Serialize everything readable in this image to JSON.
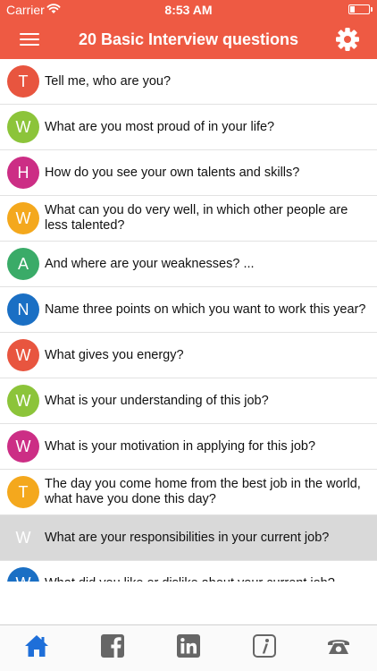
{
  "status_bar": {
    "carrier": "Carrier",
    "time": "8:53 AM",
    "battery_level": 0.25
  },
  "header": {
    "title": "20 Basic Interview questions",
    "menu_icon": "hamburger-menu-icon",
    "settings_icon": "gear-icon"
  },
  "colors": {
    "accent": "#ee5a43",
    "tab_active": "#1e6fd9",
    "tab_inactive": "#666666",
    "avatar_red": "#e8553f",
    "avatar_lime": "#8cc43a",
    "avatar_magenta": "#cc2e85",
    "avatar_amber": "#f4a81d",
    "avatar_green": "#3aab68",
    "avatar_blue": "#1a6fc4"
  },
  "questions": [
    {
      "initial": "T",
      "text": "Tell me, who are you?",
      "color": "#e8553f",
      "selected": false
    },
    {
      "initial": "W",
      "text": "What are you most proud of in your life?",
      "color": "#8cc43a",
      "selected": false
    },
    {
      "initial": "H",
      "text": "How do you see your own talents and skills?",
      "color": "#cc2e85",
      "selected": false
    },
    {
      "initial": "W",
      "text": "What can you do very well, in which other people are less talented?",
      "color": "#f4a81d",
      "selected": false
    },
    {
      "initial": "A",
      "text": "And where are your weaknesses? ...",
      "color": "#3aab68",
      "selected": false
    },
    {
      "initial": "N",
      "text": "Name three points on which you want to work this year?",
      "color": "#1a6fc4",
      "selected": false
    },
    {
      "initial": "W",
      "text": "What gives you energy?",
      "color": "#e8553f",
      "selected": false
    },
    {
      "initial": "W",
      "text": "What is your understanding of this job?",
      "color": "#8cc43a",
      "selected": false
    },
    {
      "initial": "W",
      "text": "What is your motivation in applying for this job?",
      "color": "#cc2e85",
      "selected": false
    },
    {
      "initial": "T",
      "text": "The day you come home from the best job in the world, what have you done this day?",
      "color": "#f4a81d",
      "selected": false
    },
    {
      "initial": "W",
      "text": "What are your responsibilities in your current job?",
      "color": "#3aab68",
      "selected": true
    },
    {
      "initial": "W",
      "text": "What did you like or dislike about your current job?",
      "color": "#1a6fc4",
      "selected": false
    }
  ],
  "tabs": [
    {
      "icon": "home-icon",
      "active": true
    },
    {
      "icon": "facebook-icon",
      "active": false
    },
    {
      "icon": "linkedin-icon",
      "active": false
    },
    {
      "icon": "info-icon",
      "active": false
    },
    {
      "icon": "phone-icon",
      "active": false
    }
  ]
}
